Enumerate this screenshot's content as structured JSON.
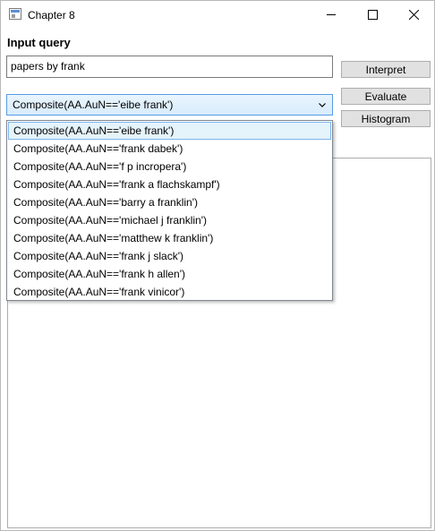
{
  "window": {
    "title": "Chapter 8"
  },
  "form": {
    "input_label": "Input query",
    "query_value": "papers by frank",
    "combo_selected": "Composite(AA.AuN=='eibe frank')",
    "buttons": {
      "interpret": "Interpret",
      "evaluate": "Evaluate",
      "histogram": "Histogram"
    }
  },
  "dropdown": {
    "selected_index": 0,
    "items": [
      "Composite(AA.AuN=='eibe frank')",
      "Composite(AA.AuN=='frank dabek')",
      "Composite(AA.AuN=='f p incropera')",
      "Composite(AA.AuN=='frank a flachskampf')",
      "Composite(AA.AuN=='barry a franklin')",
      "Composite(AA.AuN=='michael j franklin')",
      "Composite(AA.AuN=='matthew k franklin')",
      "Composite(AA.AuN=='frank j slack')",
      "Composite(AA.AuN=='frank h allen')",
      "Composite(AA.AuN=='frank vinicor')"
    ]
  },
  "icons": {
    "app": "app-window-icon",
    "minimize": "minimize-icon",
    "maximize": "maximize-icon",
    "close": "close-icon",
    "combo_arrow": "chevron-down-icon"
  }
}
